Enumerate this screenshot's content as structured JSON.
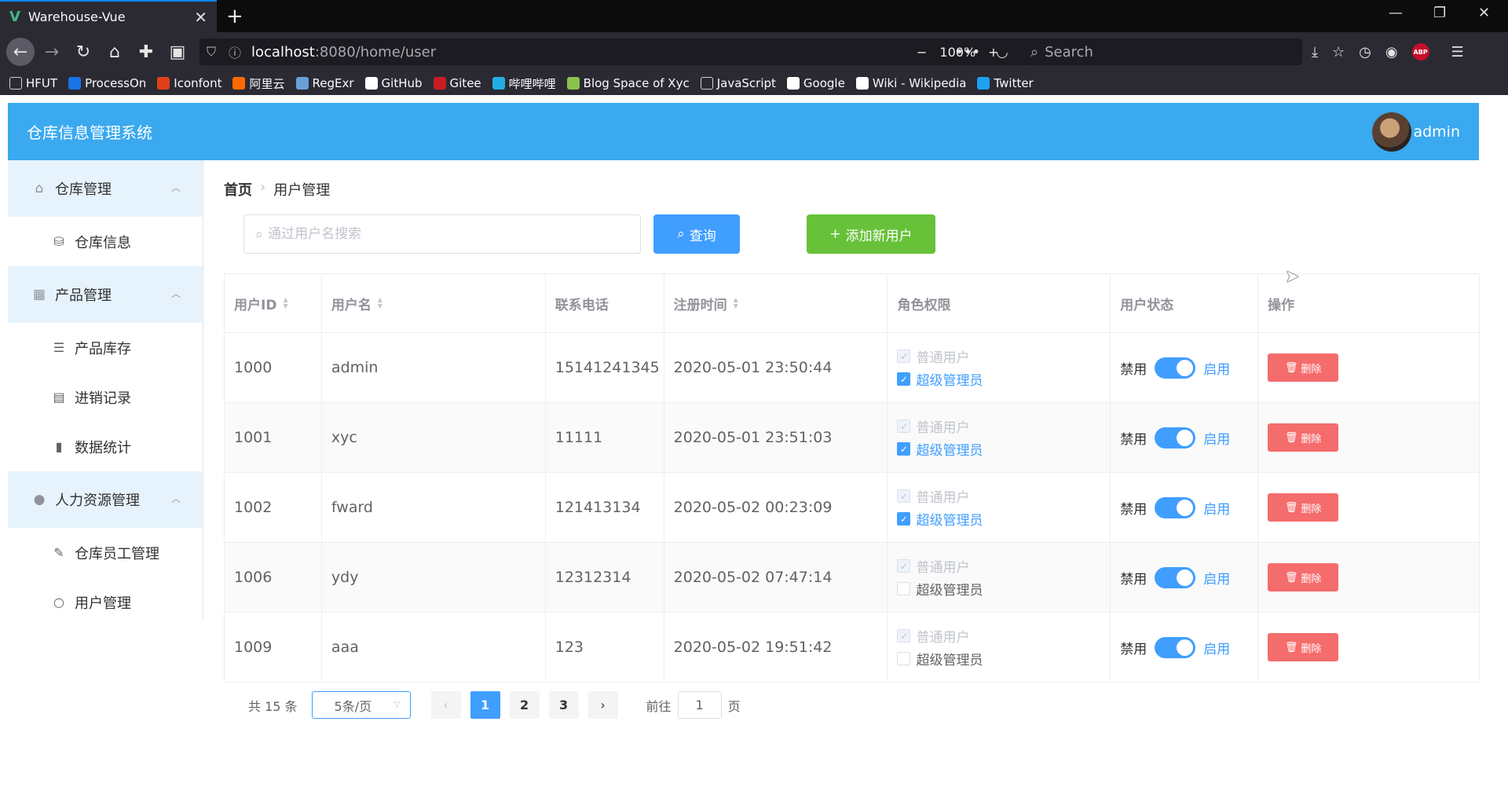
{
  "browser": {
    "tab_title": "Warehouse-Vue",
    "url_host": "localhost",
    "url_path": ":8080/home/user",
    "zoom": "100%",
    "search_placeholder": "Search",
    "bookmarks": [
      {
        "label": "HFUT",
        "icon": "folder-icon",
        "color": "#cfcfd8"
      },
      {
        "label": "ProcessOn",
        "icon": "processon-icon",
        "color": "#1a73e8"
      },
      {
        "label": "Iconfont",
        "icon": "iconfont-icon",
        "color": "#e0411b"
      },
      {
        "label": "阿里云",
        "icon": "aliyun-icon",
        "color": "#ff6a00"
      },
      {
        "label": "RegExr",
        "icon": "regexr-icon",
        "color": "#6aa0d8"
      },
      {
        "label": "GitHub",
        "icon": "github-icon",
        "color": "#ffffff"
      },
      {
        "label": "Gitee",
        "icon": "gitee-icon",
        "color": "#c71d23"
      },
      {
        "label": "哔哩哔哩",
        "icon": "bilibili-icon",
        "color": "#23ade5"
      },
      {
        "label": "Blog Space of Xyc",
        "icon": "leaf-icon",
        "color": "#8bc34a"
      },
      {
        "label": "JavaScript",
        "icon": "folder-icon",
        "color": "#cfcfd8"
      },
      {
        "label": "Google",
        "icon": "google-icon",
        "color": "#ffffff"
      },
      {
        "label": "Wiki - Wikipedia",
        "icon": "wikipedia-icon",
        "color": "#ffffff"
      },
      {
        "label": "Twitter",
        "icon": "twitter-icon",
        "color": "#1da1f2"
      }
    ]
  },
  "app": {
    "title": "仓库信息管理系统",
    "username": "admin",
    "accent_color": "#3aa9ef"
  },
  "sidebar": {
    "groups": [
      {
        "label": "仓库管理",
        "icon": "home-icon",
        "items": [
          {
            "label": "仓库信息",
            "icon": "database-icon"
          }
        ]
      },
      {
        "label": "产品管理",
        "icon": "grid-icon",
        "items": [
          {
            "label": "产品库存",
            "icon": "sliders-icon"
          },
          {
            "label": "进销记录",
            "icon": "calendar-icon"
          },
          {
            "label": "数据统计",
            "icon": "bar-chart-icon"
          }
        ]
      },
      {
        "label": "人力资源管理",
        "icon": "user-icon",
        "items": [
          {
            "label": "仓库员工管理",
            "icon": "edit-icon"
          },
          {
            "label": "用户管理",
            "icon": "user-outline-icon"
          }
        ]
      }
    ]
  },
  "breadcrumb": {
    "home": "首页",
    "current": "用户管理"
  },
  "search": {
    "placeholder": "通过用户名搜索",
    "value": ""
  },
  "buttons": {
    "query": "查询",
    "add": "添加新用户",
    "delete": "删除"
  },
  "table": {
    "headers": [
      "用户ID",
      "用户名",
      "联系电话",
      "注册时间",
      "角色权限",
      "用户状态",
      "操作"
    ],
    "role_labels": [
      "普通用户",
      "超级管理员"
    ],
    "status_off_label": "禁用",
    "status_on_label": "启用",
    "rows": [
      {
        "id": "1000",
        "name": "admin",
        "phone": "15141241345",
        "time": "2020-05-01 23:50:44",
        "super": true,
        "enabled": true
      },
      {
        "id": "1001",
        "name": "xyc",
        "phone": "11111",
        "time": "2020-05-01 23:51:03",
        "super": true,
        "enabled": true
      },
      {
        "id": "1002",
        "name": "fward",
        "phone": "121413134",
        "time": "2020-05-02 00:23:09",
        "super": true,
        "enabled": true
      },
      {
        "id": "1006",
        "name": "ydy",
        "phone": "12312314",
        "time": "2020-05-02 07:47:14",
        "super": false,
        "enabled": true
      },
      {
        "id": "1009",
        "name": "aaa",
        "phone": "123",
        "time": "2020-05-02 19:51:42",
        "super": false,
        "enabled": true
      }
    ]
  },
  "pagination": {
    "total": "共 15 条",
    "page_size": "5条/页",
    "pages": [
      "1",
      "2",
      "3"
    ],
    "current": "1",
    "goto_prefix": "前往",
    "goto_value": "1",
    "goto_suffix": "页"
  }
}
